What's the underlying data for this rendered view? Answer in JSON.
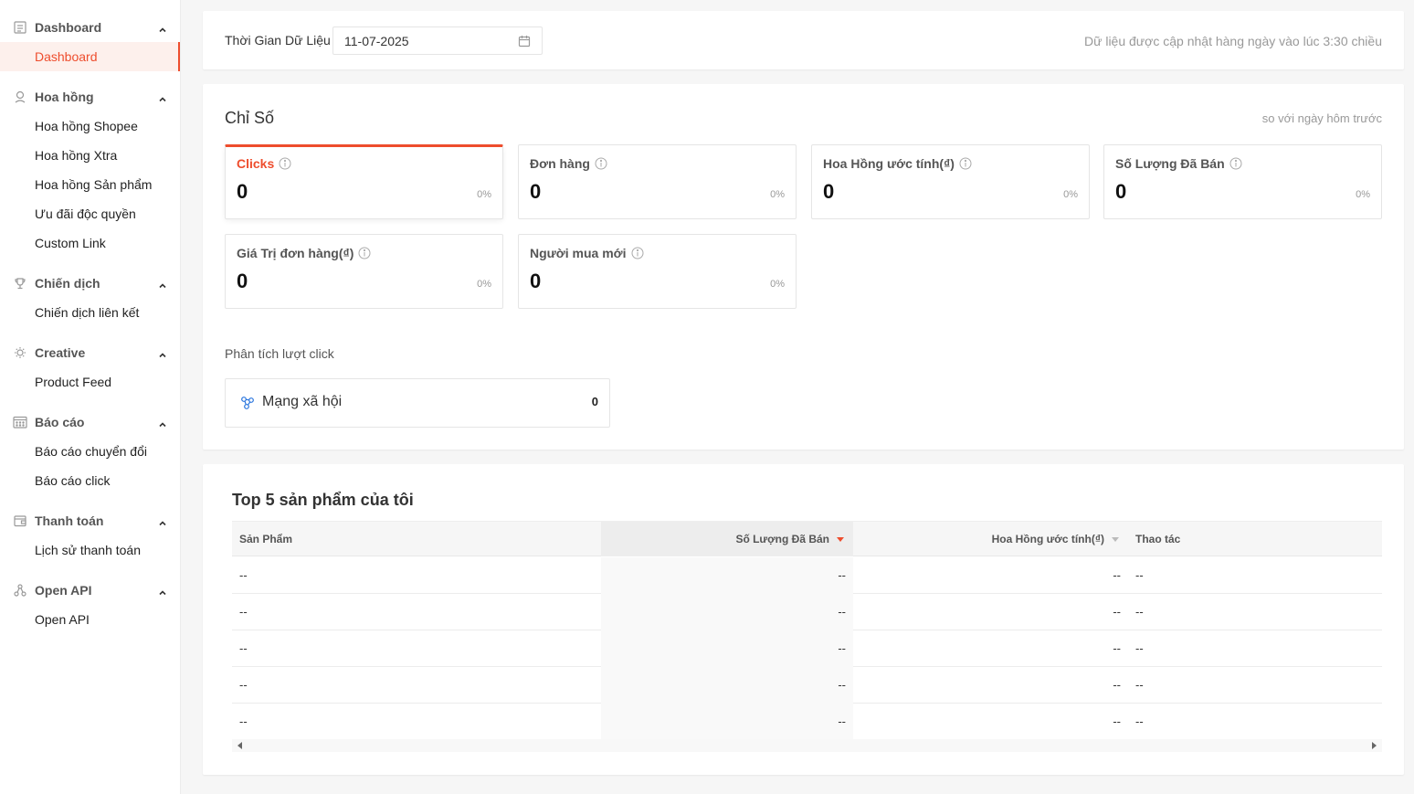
{
  "sidebar": {
    "groups": [
      {
        "label": "Dashboard",
        "icon": "dashboard-icon",
        "items": [
          {
            "label": "Dashboard",
            "active": true
          }
        ]
      },
      {
        "label": "Hoa hồng",
        "icon": "commission-icon",
        "items": [
          {
            "label": "Hoa hồng Shopee"
          },
          {
            "label": "Hoa hồng Xtra"
          },
          {
            "label": "Hoa hồng Sản phẩm"
          },
          {
            "label": "Ưu đãi độc quyền"
          },
          {
            "label": "Custom Link"
          }
        ]
      },
      {
        "label": "Chiến dịch",
        "icon": "trophy-icon",
        "items": [
          {
            "label": "Chiến dịch liên kết"
          }
        ]
      },
      {
        "label": "Creative",
        "icon": "lightbulb-icon",
        "items": [
          {
            "label": "Product Feed"
          }
        ]
      },
      {
        "label": "Báo cáo",
        "icon": "calendar-grid-icon",
        "items": [
          {
            "label": "Báo cáo chuyển đổi"
          },
          {
            "label": "Báo cáo click"
          }
        ]
      },
      {
        "label": "Thanh toán",
        "icon": "wallet-icon",
        "items": [
          {
            "label": "Lịch sử thanh toán"
          }
        ]
      },
      {
        "label": "Open API",
        "icon": "api-icon",
        "items": [
          {
            "label": "Open API"
          }
        ]
      }
    ]
  },
  "date_filter": {
    "label": "Thời Gian Dữ Liệu",
    "value": "11-07-2025",
    "note": "Dữ liệu được cập nhật hàng ngày vào lúc 3:30 chiều"
  },
  "metrics": {
    "title": "Chỉ Số",
    "compare_note": "so với ngày hôm trước",
    "cards": [
      {
        "label": "Clicks",
        "value": "0",
        "change": "0%",
        "active": true
      },
      {
        "label": "Đơn hàng",
        "value": "0",
        "change": "0%"
      },
      {
        "label": "Hoa Hồng ước tính(₫)",
        "value": "0",
        "change": "0%"
      },
      {
        "label": "Số Lượng Đã Bán",
        "value": "0",
        "change": "0%"
      },
      {
        "label": "Giá Trị đơn hàng(₫)",
        "value": "0",
        "change": "0%"
      },
      {
        "label": "Người mua mới",
        "value": "0",
        "change": "0%"
      }
    ],
    "click_analysis": {
      "title": "Phân tích lượt click",
      "channel_label": "Mạng xã hội",
      "channel_count": "0"
    }
  },
  "top5": {
    "title": "Top 5 sản phẩm của tôi",
    "columns": {
      "product": "Sản Phẩm",
      "sold": "Số Lượng Đã Bán",
      "commission": "Hoa Hồng ước tính(₫)",
      "action": "Thao tác"
    },
    "rows": [
      {
        "product": "--",
        "sold": "--",
        "commission": "--",
        "action": "--"
      },
      {
        "product": "--",
        "sold": "--",
        "commission": "--",
        "action": "--"
      },
      {
        "product": "--",
        "sold": "--",
        "commission": "--",
        "action": "--"
      },
      {
        "product": "--",
        "sold": "--",
        "commission": "--",
        "action": "--"
      },
      {
        "product": "--",
        "sold": "--",
        "commission": "--",
        "action": "--"
      }
    ]
  },
  "colors": {
    "accent": "#ee4d2d",
    "link_blue": "#2673dd"
  }
}
